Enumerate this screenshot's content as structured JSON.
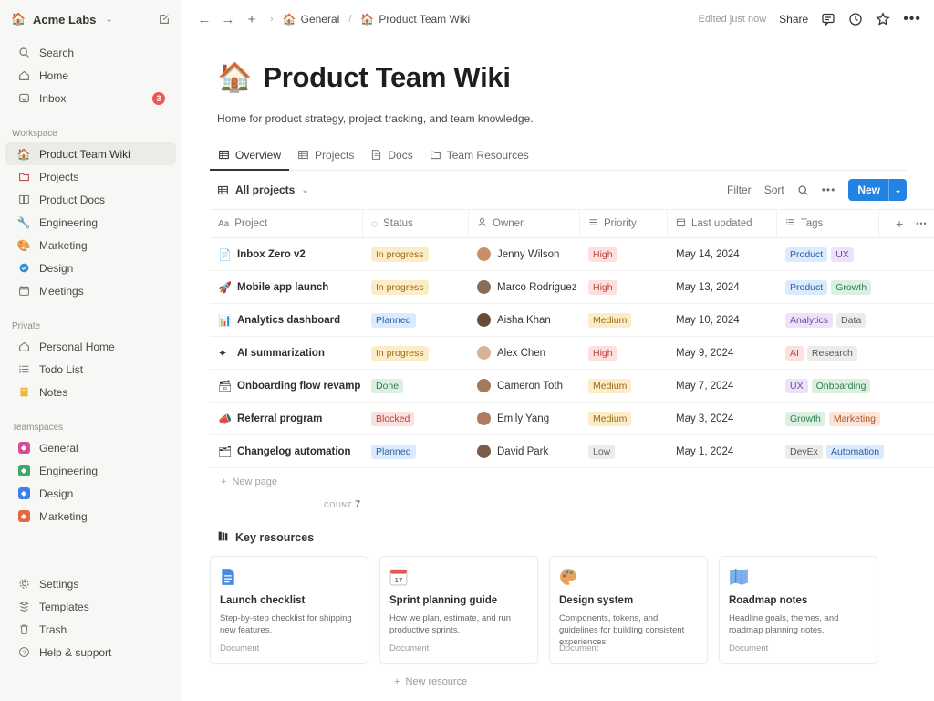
{
  "sidebar": {
    "workspace": "Acme Labs",
    "top": [
      {
        "label": "Search",
        "icon": "search-icon"
      },
      {
        "label": "Home",
        "icon": "home-icon"
      },
      {
        "label": "Inbox",
        "icon": "inbox-icon",
        "badge": "3"
      }
    ],
    "workspace_label": "Workspace",
    "workspace_items": [
      {
        "label": "Product Team Wiki",
        "emoji": "🏠"
      },
      {
        "label": "Projects",
        "icon": "folder-icon"
      },
      {
        "label": "Product Docs",
        "icon": "docs-icon"
      },
      {
        "label": "Engineering",
        "emoji": "🔧"
      },
      {
        "label": "Marketing",
        "emoji": "🎨"
      },
      {
        "label": "Design",
        "emoji": "🌐"
      },
      {
        "label": "Meetings",
        "icon": "calendar-icon"
      }
    ],
    "private_label": "Private",
    "private_items": [
      {
        "label": "Personal Home",
        "icon": "home-icon"
      },
      {
        "label": "Todo List",
        "icon": "list-icon"
      },
      {
        "label": "Notes",
        "emoji": "📒"
      }
    ],
    "teamspaces_label": "Teamspaces",
    "teamspaces": [
      {
        "label": "General",
        "color": "#d44c9a"
      },
      {
        "label": "Engineering",
        "color": "#3fa66b"
      },
      {
        "label": "Design",
        "color": "#3f7ee8"
      },
      {
        "label": "Marketing",
        "color": "#e8663f"
      }
    ],
    "bottom": [
      {
        "label": "Settings",
        "icon": "gear-icon"
      },
      {
        "label": "Templates",
        "icon": "templates-icon"
      },
      {
        "label": "Trash",
        "icon": "trash-icon"
      },
      {
        "label": "Help & support",
        "icon": "help-icon"
      }
    ]
  },
  "topbar": {
    "crumb1": "General",
    "crumb2": "Product Team Wiki",
    "edited": "Edited just now",
    "share": "Share"
  },
  "page": {
    "emoji": "🏠",
    "title": "Product Team Wiki",
    "desc": "Home for product strategy, project tracking, and team knowledge."
  },
  "tabs": [
    "Overview",
    "Projects",
    "Docs",
    "Team Resources"
  ],
  "view": {
    "name": "All projects",
    "filter": "Filter",
    "sort": "Sort",
    "new": "New"
  },
  "columns": [
    "Project",
    "Status",
    "Owner",
    "Priority",
    "Last updated",
    "Tags"
  ],
  "rows": [
    {
      "icon": "📄",
      "name": "Inbox Zero v2",
      "status": "In progress",
      "owner": "Jenny Wilson",
      "priority": "High",
      "updated": "May 14, 2024",
      "tags": [
        "Product",
        "UX"
      ]
    },
    {
      "icon": "🚀",
      "name": "Mobile app launch",
      "status": "In progress",
      "owner": "Marco Rodriguez",
      "priority": "High",
      "updated": "May 13, 2024",
      "tags": [
        "Product",
        "Growth"
      ]
    },
    {
      "icon": "📊",
      "name": "Analytics dashboard",
      "status": "Planned",
      "owner": "Aisha Khan",
      "priority": "Medium",
      "updated": "May 10, 2024",
      "tags": [
        "Analytics",
        "Data"
      ]
    },
    {
      "icon": "✦",
      "name": "AI summarization",
      "status": "In progress",
      "owner": "Alex Chen",
      "priority": "High",
      "updated": "May 9, 2024",
      "tags": [
        "AI",
        "Research"
      ]
    },
    {
      "icon": "🗃",
      "name": "Onboarding flow revamp",
      "status": "Done",
      "owner": "Cameron Toth",
      "priority": "Medium",
      "updated": "May 7, 2024",
      "tags": [
        "UX",
        "Onboarding"
      ]
    },
    {
      "icon": "📣",
      "name": "Referral program",
      "status": "Blocked",
      "owner": "Emily Yang",
      "priority": "Medium",
      "updated": "May 3, 2024",
      "tags": [
        "Growth",
        "Marketing"
      ]
    },
    {
      "icon": "🗂",
      "name": "Changelog automation",
      "status": "Planned",
      "owner": "David Park",
      "priority": "Low",
      "updated": "May 1, 2024",
      "tags": [
        "DevEx",
        "Automation"
      ]
    }
  ],
  "new_page": "New page",
  "count_label": "COUNT",
  "count": "7",
  "resources": {
    "heading": "Key resources",
    "new": "New resource",
    "cards": [
      {
        "title": "Launch checklist",
        "desc": "Step-by-step checklist for shipping new features.",
        "type": "Document",
        "icon": "document-icon"
      },
      {
        "title": "Sprint planning guide",
        "desc": "How we plan, estimate, and run productive sprints.",
        "type": "Document",
        "icon": "calendar-icon"
      },
      {
        "title": "Design system",
        "desc": "Components, tokens, and guidelines for building consistent experiences.",
        "type": "Document",
        "icon": "palette-icon"
      },
      {
        "title": "Roadmap notes",
        "desc": "Headline goals, themes, and roadmap planning notes.",
        "type": "Document",
        "icon": "map-icon"
      }
    ]
  },
  "colors": {
    "accent": "#2383e2"
  }
}
